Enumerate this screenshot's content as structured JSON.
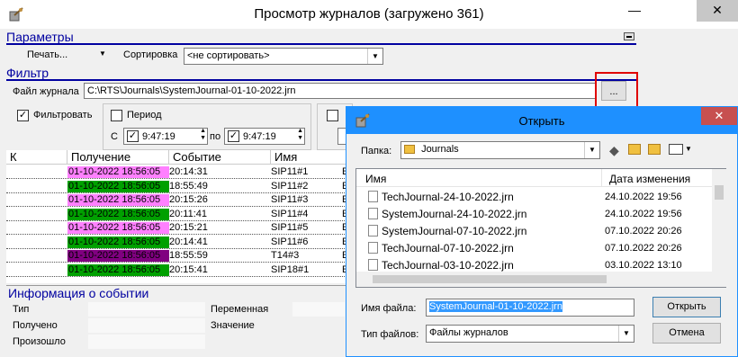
{
  "window": {
    "title": "Просмотр журналов (загружено 361)",
    "min_glyph": "—",
    "close_glyph": "✕"
  },
  "params": {
    "header": "Параметры",
    "print_label": "Печать...",
    "sort_label": "Сортировка",
    "sort_value": "<не сортировать>"
  },
  "filter": {
    "header": "Фильтр",
    "file_label": "Файл журнала",
    "file_value": "C:\\RTS\\Journals\\SystemJournal-01-10-2022.jrn",
    "browse_label": "...",
    "filter_check_label": "Фильтровать",
    "period_label": "Период",
    "from_label": "С",
    "to_label": "по",
    "time_from": "9:47:19",
    "time_to": "9:47:19"
  },
  "table": {
    "columns": [
      "К",
      "Получение",
      "Событие",
      "Имя"
    ],
    "rows": [
      {
        "received": "01-10-2022 18:56:05",
        "event": "20:14:31",
        "name": "SIP11#1",
        "extra": "E",
        "color": "#ff80ff"
      },
      {
        "received": "01-10-2022 18:56:05",
        "event": "18:55:49",
        "name": "SIP11#2",
        "extra": "E",
        "color": "#00a000"
      },
      {
        "received": "01-10-2022 18:56:05",
        "event": "20:15:26",
        "name": "SIP11#3",
        "extra": "E",
        "color": "#ff80ff"
      },
      {
        "received": "01-10-2022 18:56:05",
        "event": "20:11:41",
        "name": "SIP11#4",
        "extra": "E",
        "color": "#00a000"
      },
      {
        "received": "01-10-2022 18:56:05",
        "event": "20:15:21",
        "name": "SIP11#5",
        "extra": "E",
        "color": "#ff80ff"
      },
      {
        "received": "01-10-2022 18:56:05",
        "event": "20:14:41",
        "name": "SIP11#6",
        "extra": "E",
        "color": "#00a000"
      },
      {
        "received": "01-10-2022 18:56:05",
        "event": "18:55:59",
        "name": "T14#3",
        "extra": "E",
        "color": "#800080"
      },
      {
        "received": "01-10-2022 18:56:05",
        "event": "20:15:41",
        "name": "SIP18#1",
        "extra": "E",
        "color": "#00a000"
      }
    ]
  },
  "event_info": {
    "header": "Информация о событии",
    "type_label": "Тип",
    "received_label": "Получено",
    "occurred_label": "Произошло",
    "variable_label": "Переменная",
    "value_label": "Значение"
  },
  "dialog": {
    "title": "Открыть",
    "close_glyph": "✕",
    "folder_label": "Папка:",
    "folder_value": "Journals",
    "col_name": "Имя",
    "col_date": "Дата изменения",
    "files": [
      {
        "name": "TechJournal-24-10-2022.jrn",
        "date": "24.10.2022 19:56"
      },
      {
        "name": "SystemJournal-24-10-2022.jrn",
        "date": "24.10.2022 19:56"
      },
      {
        "name": "SystemJournal-07-10-2022.jrn",
        "date": "07.10.2022 20:26"
      },
      {
        "name": "TechJournal-07-10-2022.jrn",
        "date": "07.10.2022 20:26"
      },
      {
        "name": "TechJournal-03-10-2022.jrn",
        "date": "03.10.2022 13:10"
      }
    ],
    "filename_label": "Имя файла:",
    "filename_value": "SystemJournal-01-10-2022.jrn",
    "filetype_label": "Тип файлов:",
    "filetype_value": "Файлы журналов",
    "open_label": "Открыть",
    "cancel_label": "Отмена"
  }
}
